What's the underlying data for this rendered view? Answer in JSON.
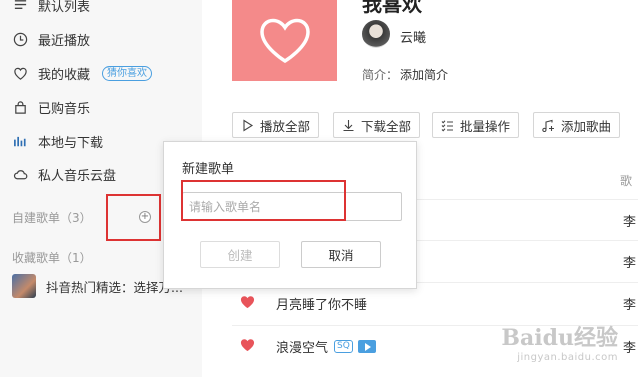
{
  "sidebar": {
    "items": [
      {
        "label": "默认列表",
        "icon": "list-icon"
      },
      {
        "label": "最近播放",
        "icon": "clock-icon"
      },
      {
        "label": "我的收藏",
        "icon": "heart-outline-icon",
        "badge": "猜你喜欢"
      },
      {
        "label": "已购音乐",
        "icon": "bag-icon"
      },
      {
        "label": "本地与下载",
        "icon": "bars-icon"
      },
      {
        "label": "私人音乐云盘",
        "icon": "cloud-icon"
      }
    ],
    "created_header": "自建歌单（3）",
    "collected_header": "收藏歌单（1）",
    "collected_item": "抖音热门精选：选择万..."
  },
  "playlist": {
    "title": "我喜欢",
    "creator": "云曦",
    "intro_label": "简介：",
    "intro_value": "添加简介"
  },
  "toolbar": {
    "play_all": "播放全部",
    "download_all": "下载全部",
    "batch": "批量操作",
    "add_song": "添加歌曲"
  },
  "table": {
    "artist_header": "歌",
    "rows": [
      {
        "title": "",
        "artist": "李"
      },
      {
        "title": "",
        "artist": "李"
      },
      {
        "title": "月亮睡了你不睡",
        "artist": "李"
      },
      {
        "title": "浪漫空气",
        "artist": "李",
        "tag_sq": "SQ"
      }
    ]
  },
  "dialog": {
    "title": "新建歌单",
    "placeholder": "请输入歌单名",
    "value": "",
    "create_label": "创建",
    "cancel_label": "取消"
  },
  "watermark": {
    "main": "Baidu经验",
    "sub": "jingyan.baidu.com"
  },
  "colors": {
    "accent_red": "#dd3333",
    "cover_pink": "#f48a8a",
    "heart_red": "#e8545a",
    "badge_blue": "#4a9fe0"
  }
}
